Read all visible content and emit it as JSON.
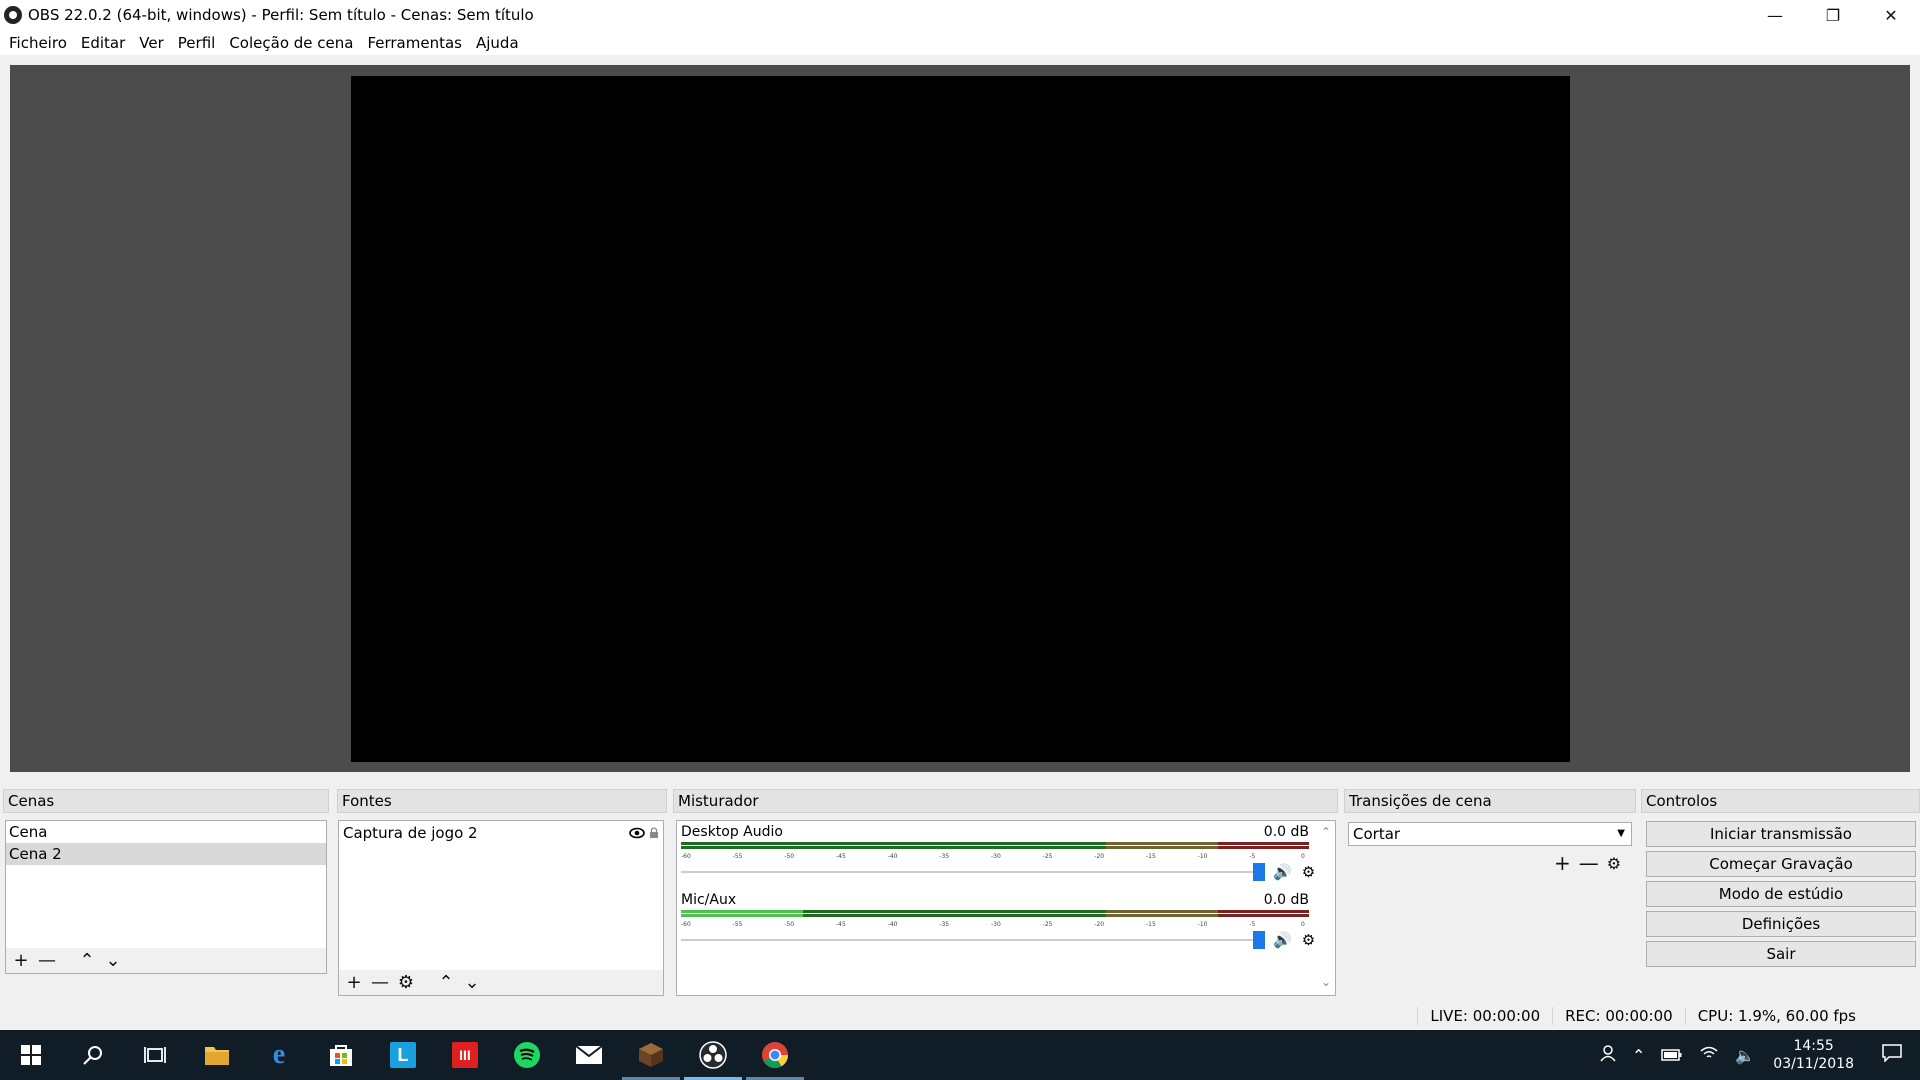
{
  "window": {
    "title": "OBS 22.0.2 (64-bit, windows) - Perfil: Sem título - Cenas: Sem título",
    "minimize": "—",
    "maximize": "❐",
    "close": "✕"
  },
  "menu": [
    "Ficheiro",
    "Editar",
    "Ver",
    "Perfil",
    "Coleção de cena",
    "Ferramentas",
    "Ajuda"
  ],
  "scenes": {
    "title": "Cenas",
    "items": [
      "Cena",
      "Cena 2"
    ],
    "selected_index": 1
  },
  "sources": {
    "title": "Fontes",
    "items": [
      {
        "name": "Captura de jogo 2",
        "visible": true,
        "locked": false
      }
    ]
  },
  "mixer": {
    "title": "Misturador",
    "tick_labels": [
      "-60",
      "-55",
      "-50",
      "-45",
      "-40",
      "-35",
      "-30",
      "-25",
      "-20",
      "-15",
      "-10",
      "-5",
      "0"
    ],
    "channels": [
      {
        "name": "Desktop Audio",
        "level": "0.0 dB",
        "volume": 1.0,
        "muted": false
      },
      {
        "name": "Mic/Aux",
        "level": "0.0 dB",
        "volume": 1.0,
        "muted": false
      }
    ]
  },
  "transitions": {
    "title": "Transições de cena",
    "selected": "Cortar"
  },
  "controls": {
    "title": "Controlos",
    "buttons": [
      "Iniciar transmissão",
      "Começar Gravação",
      "Modo de estúdio",
      "Definições",
      "Sair"
    ]
  },
  "status": {
    "live": "LIVE: 00:00:00",
    "rec": "REC: 00:00:00",
    "cpu": "CPU: 1.9%, 60.00 fps"
  },
  "taskbar": {
    "icons": [
      "windows-start-icon",
      "search-icon",
      "task-view-icon",
      "file-explorer-icon",
      "edge-icon",
      "store-icon",
      "l-app-icon",
      "red-app-icon",
      "spotify-icon",
      "mail-icon",
      "minecraft-icon",
      "obs-icon",
      "chrome-icon"
    ],
    "clock_time": "14:55",
    "clock_date": "03/11/2018"
  },
  "colors": {
    "preview_bg": "#4c4c4c",
    "canvas": "#000000",
    "fader": "#1979e8",
    "taskbar": "#101c26"
  }
}
